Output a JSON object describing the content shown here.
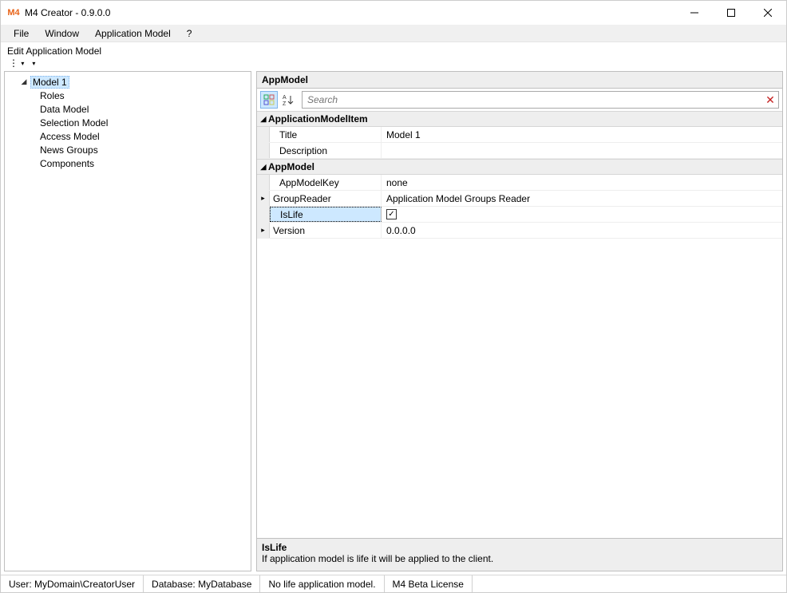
{
  "window": {
    "title": "M4 Creator - 0.9.0.0",
    "logo_text": "M4"
  },
  "menu": {
    "file": "File",
    "window": "Window",
    "app_model": "Application Model",
    "help": "?"
  },
  "tree_panel": {
    "header": "Edit Application Model",
    "root": "Model 1",
    "items": [
      "Roles",
      "Data Model",
      "Selection Model",
      "Access Model",
      "News Groups",
      "Components"
    ]
  },
  "property_panel": {
    "header": "AppModel",
    "search_placeholder": "Search",
    "categories": [
      {
        "name": "ApplicationModelItem",
        "rows": [
          {
            "name": "Title",
            "value": "Model 1",
            "expandable": false
          },
          {
            "name": "Description",
            "value": "",
            "expandable": false
          }
        ]
      },
      {
        "name": "AppModel",
        "rows": [
          {
            "name": "AppModelKey",
            "value": "none",
            "expandable": false
          },
          {
            "name": "GroupReader",
            "value": "Application Model Groups Reader",
            "expandable": true
          },
          {
            "name": "IsLife",
            "value": true,
            "type": "checkbox",
            "expandable": false,
            "selected": true
          },
          {
            "name": "Version",
            "value": "0.0.0.0",
            "expandable": true
          }
        ]
      }
    ],
    "help": {
      "title": "IsLife",
      "text": "If application model is life it will be applied to the client."
    }
  },
  "status": {
    "user": "User: MyDomain\\CreatorUser",
    "db": "Database: MyDatabase",
    "life": "No life application model.",
    "license": "M4 Beta License"
  }
}
